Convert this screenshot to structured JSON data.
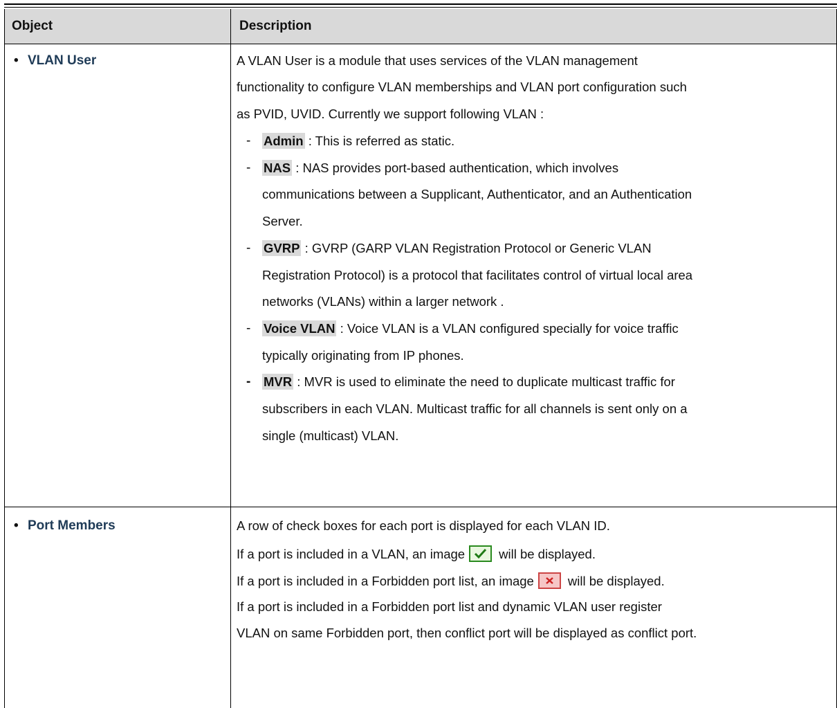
{
  "header": {
    "object": "Object",
    "description": "Description"
  },
  "rows": [
    {
      "object": "VLAN User",
      "intro": [
        "A VLAN User is a module that uses services of the VLAN management",
        "functionality to configure VLAN memberships and VLAN port configuration such",
        "as PVID, UVID. Currently we support following VLAN :"
      ],
      "items": [
        {
          "term": "Admin",
          "lines": [
            " : This is referred as static."
          ]
        },
        {
          "term": "NAS",
          "lines": [
            " : NAS provides port-based authentication, which involves",
            "communications between a Supplicant, Authenticator, and an Authentication",
            "Server."
          ]
        },
        {
          "term": "GVRP",
          "lines": [
            " : GVRP (GARP VLAN Registration Protocol or Generic VLAN",
            "Registration Protocol) is a protocol that facilitates control of virtual local area",
            "networks (VLANs) within a larger network ."
          ]
        },
        {
          "term": "Voice VLAN",
          "lines": [
            " : Voice VLAN is a VLAN configured specially for voice traffic",
            "typically originating from IP phones."
          ]
        },
        {
          "term": "MVR",
          "lines": [
            " : MVR is used to eliminate the need to duplicate multicast traffic for",
            "subscribers in each VLAN. Multicast traffic for all channels is sent only on a",
            "single (multicast) VLAN."
          ]
        }
      ]
    },
    {
      "object": "Port Members",
      "lines": [
        "A row of check boxes for each port is displayed for each VLAN ID.",
        "If a port is included in a VLAN, an image",
        "will be displayed.",
        "If a port is included in a Forbidden port list, an image",
        "will be displayed.",
        "If a port is included in a Forbidden port list and dynamic VLAN user register",
        "VLAN on same Forbidden port, then conflict port will be displayed as conflict port."
      ],
      "icons": [
        "check-image-icon",
        "forbidden-image-icon"
      ]
    }
  ]
}
